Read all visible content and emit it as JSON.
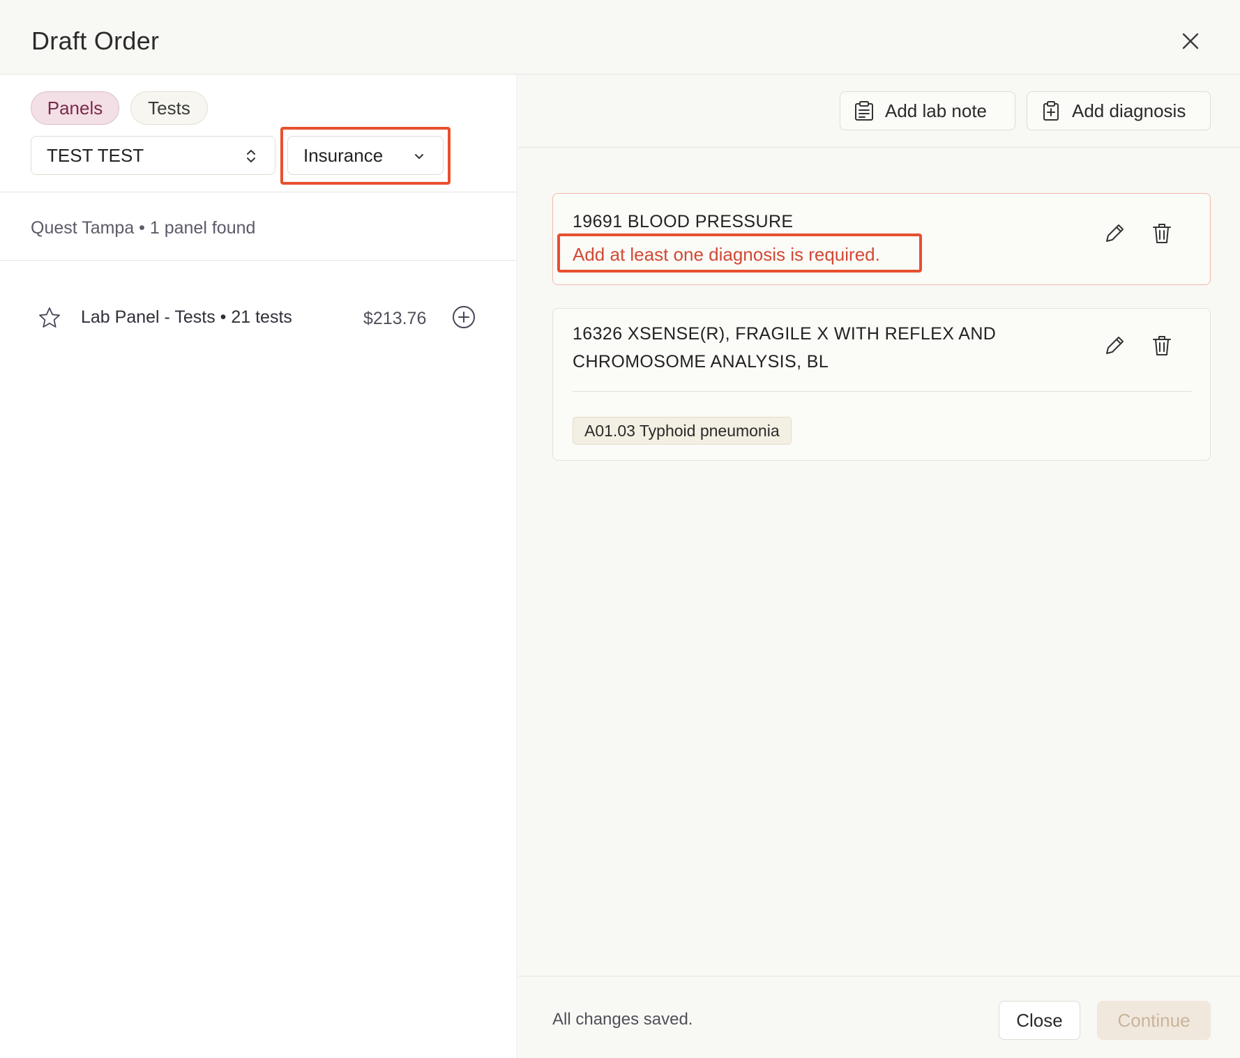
{
  "header": {
    "title": "Draft Order",
    "close_icon": "close-icon"
  },
  "left": {
    "tabs": [
      {
        "label": "Panels",
        "active": true
      },
      {
        "label": "Tests",
        "active": false
      }
    ],
    "patient_select": {
      "value": "TEST TEST"
    },
    "billing_select": {
      "value": "Insurance"
    },
    "results_info": "Quest Tampa • 1 panel found",
    "panels": [
      {
        "name": "Lab Panel - Tests • 21 tests",
        "price": "$213.76",
        "favorite": false
      }
    ]
  },
  "right": {
    "actions": {
      "lab_note": "Add lab note",
      "diagnosis": "Add diagnosis"
    },
    "orders": [
      {
        "title": "19691 BLOOD PRESSURE",
        "error": "Add at least one diagnosis is required."
      },
      {
        "title_line1": "16326 XSENSE(R), FRAGILE X WITH REFLEX AND",
        "title_line2": "CHROMOSOME ANALYSIS, BL",
        "diagnosis": "A01.03 Typhoid pneumonia"
      }
    ],
    "footer": {
      "status": "All changes saved.",
      "close": "Close",
      "continue": "Continue"
    }
  },
  "colors": {
    "accent_error": "#e8502e",
    "error_text": "#d04a34",
    "active_pill": "#f3dfe6",
    "continue_disabled": "#f1e8dd"
  }
}
